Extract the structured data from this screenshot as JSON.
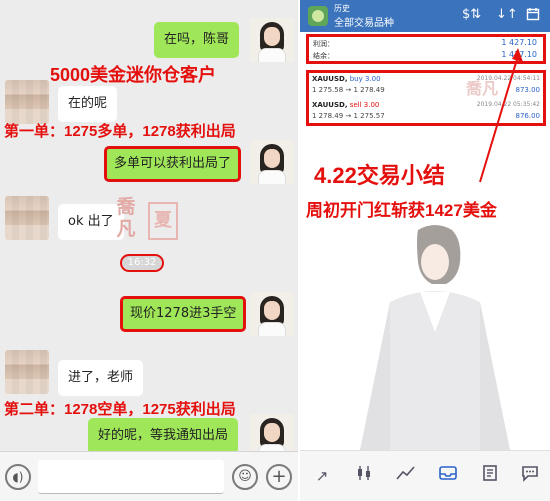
{
  "chat": {
    "caption_top": "5000美金迷你仓客户",
    "caption_first": "第一单：1275多单，1278获利出局",
    "caption_second": "第二单：1278空单，1275获利出局",
    "messages": [
      {
        "from": "me",
        "text": "在吗，陈哥"
      },
      {
        "from": "other",
        "text": "在的呢"
      },
      {
        "from": "me",
        "text": "多单可以获利出局了"
      },
      {
        "from": "other",
        "text": "ok 出了"
      },
      {
        "from": "me",
        "text": "现价1278进3手空"
      },
      {
        "from": "other",
        "text": "进了，老师"
      },
      {
        "from": "me",
        "text": "好的呢，等我通知出局"
      }
    ],
    "time_chip": "16:32",
    "seal": {
      "left": "喬凡",
      "right": "夏"
    }
  },
  "app": {
    "header_small": "历史",
    "header_title": "全部交易品种",
    "icons": [
      "dollar-sort-icon",
      "sort-icon",
      "calendar-icon"
    ],
    "summary": {
      "profit_label": "利润：",
      "profit_value": "1 427.10",
      "balance_label": "结余：",
      "balance_value": "1 427.10"
    },
    "orders": [
      {
        "symbol": "XAUUSD,",
        "side": "buy 3.00",
        "time": "2019.04.22 04:54:11",
        "from_to": "1 275.58 → 1 278.49",
        "profit": "873.00"
      },
      {
        "symbol": "XAUUSD,",
        "side": "sell 3.00",
        "time": "2019.04.22 05:35:42",
        "from_to": "1 278.49 → 1 275.57",
        "profit": "876.00"
      }
    ],
    "caption_date": "4.22交易小结",
    "caption_profit": "周初开门红斩获1427美金",
    "seal_text": "喬凡",
    "nav": [
      "chart-icon",
      "candles-icon",
      "trend-icon",
      "history-icon",
      "news-icon",
      "chat-icon"
    ]
  },
  "colors": {
    "highlight": "#e4100e",
    "bubble_me": "#9fe658",
    "app_blue": "#3b73bd"
  }
}
